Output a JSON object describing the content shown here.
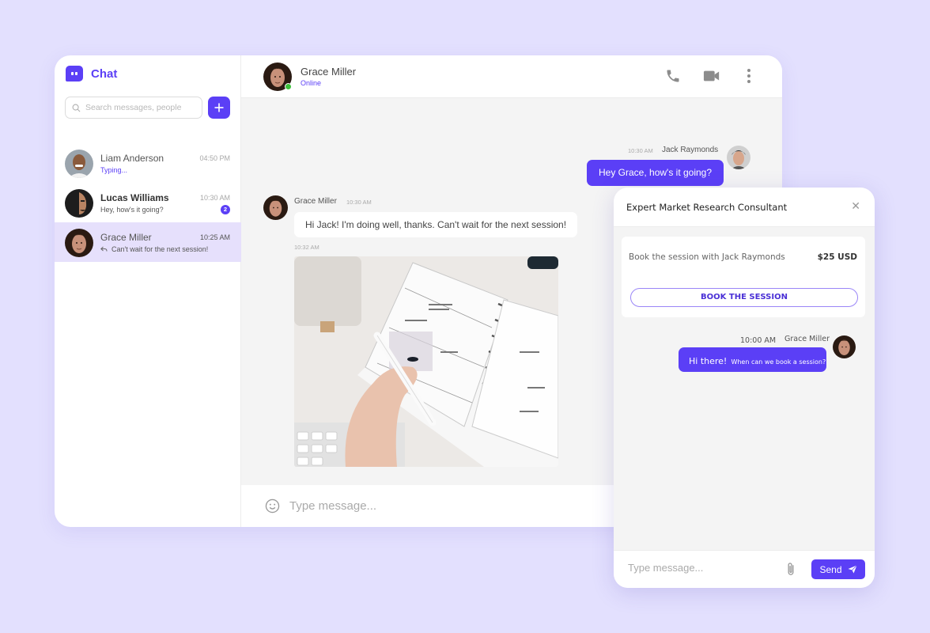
{
  "app": {
    "brand": "Chat",
    "search_placeholder": "Search messages, people",
    "add_button_icon": "plus-icon"
  },
  "contacts": [
    {
      "name": "Liam Anderson",
      "time": "04:50 PM",
      "preview": "Typing...",
      "typing": true,
      "unread": null,
      "active": false
    },
    {
      "name": "Lucas Williams",
      "time": "10:30 AM",
      "preview": "Hey, how's it going?",
      "typing": false,
      "unread": "2",
      "active": false
    },
    {
      "name": "Grace Miller",
      "time": "10:25 AM",
      "preview": "Can't wait for the next session!",
      "typing": false,
      "unread": null,
      "active": true,
      "reply_icon": "reply-icon"
    }
  ],
  "chat": {
    "contact_name": "Grace Miller",
    "status": "Online",
    "header_icons": [
      "phone-icon",
      "video-camera-icon",
      "more-vertical-icon"
    ],
    "messages": [
      {
        "sender": "Jack Raymonds",
        "time": "10:30 AM",
        "text": "Hey Grace, how's it going?",
        "outgoing": true
      },
      {
        "sender": "Grace Miller",
        "time": "10:30 AM",
        "text": "Hi Jack! I'm doing well, thanks. Can't wait for the next session!",
        "outgoing": false
      },
      {
        "sender": "Grace Miller",
        "time": "10:32 AM",
        "attachment": "photo of hand writing in planner",
        "outgoing": false
      }
    ],
    "composer_placeholder": "Type message..."
  },
  "colors": {
    "accent": "#5b3ff6",
    "background": "#e3e0fe",
    "active_contact": "#e6e0fc",
    "online": "#3cc13b"
  },
  "booking_panel": {
    "title": "Expert Market Research Consultant",
    "close_icon": "close-icon",
    "description": "Book the session with Jack Raymonds",
    "price": "$25 USD",
    "button_label": "BOOK THE SESSION",
    "message": {
      "sender": "Grace Miller",
      "time": "10:00 AM",
      "greeting": "Hi there!",
      "text": "When can we book a session?"
    },
    "composer_placeholder": "Type message...",
    "send_label": "Send"
  }
}
